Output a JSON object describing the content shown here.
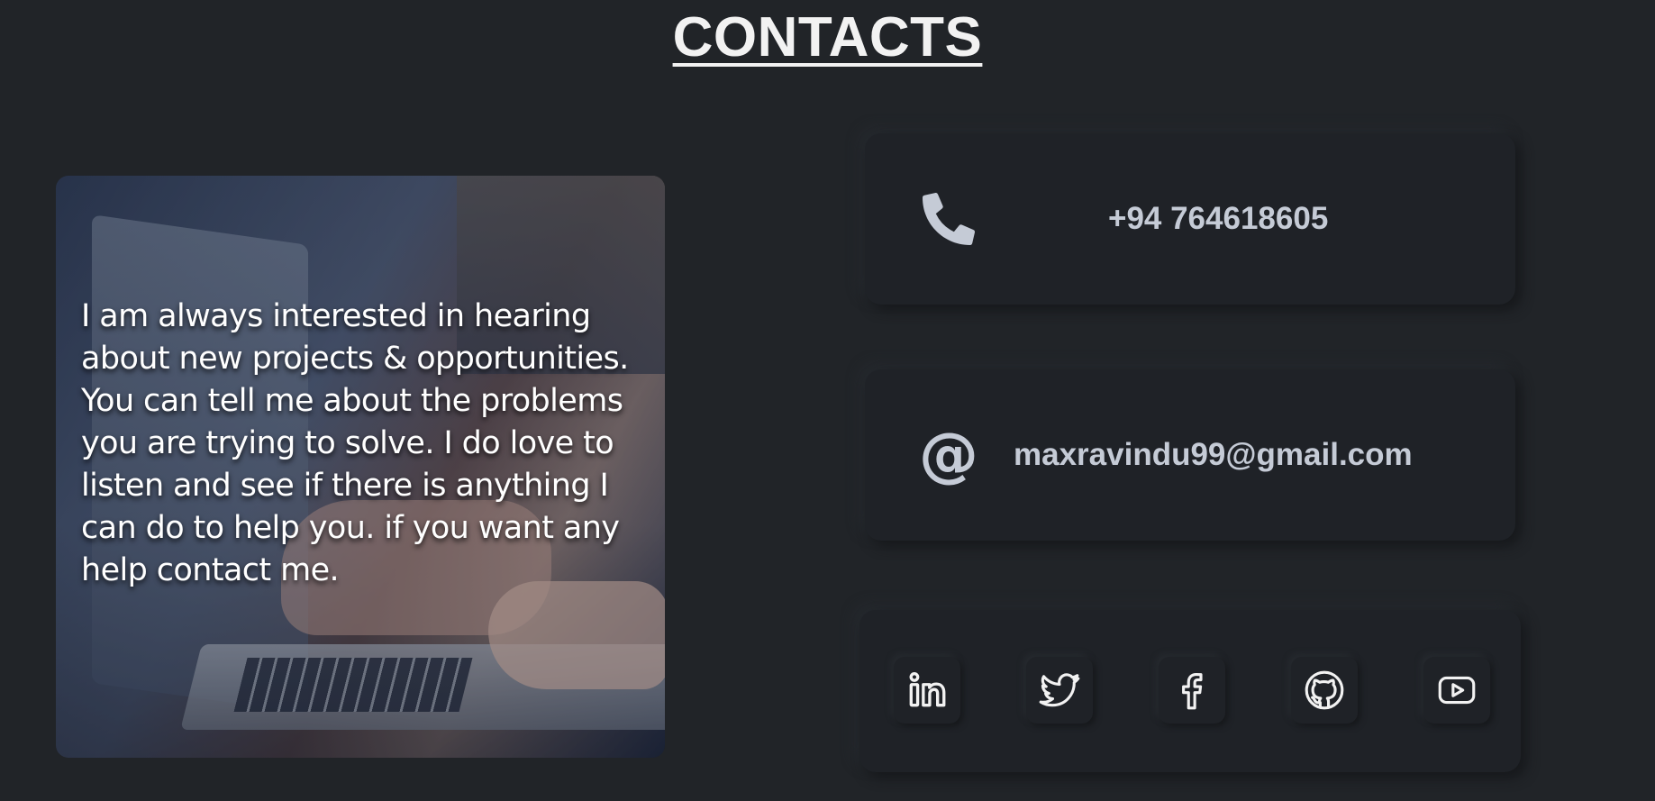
{
  "section": {
    "title": "CONTACTS"
  },
  "about": {
    "message": "I am always interested in hearing about new projects & opportunities. You can tell me about the problems you are trying to solve. I do love to listen and see if there is anything I can do to help you. if you want any help contact me."
  },
  "contact": {
    "phone": {
      "icon": "phone-icon",
      "value": "+94 764618605"
    },
    "email": {
      "icon": "at-icon",
      "glyph": "@",
      "value": "maxravindu99@gmail.com"
    }
  },
  "social": [
    {
      "name": "linkedin",
      "icon": "linkedin-icon"
    },
    {
      "name": "twitter",
      "icon": "twitter-icon"
    },
    {
      "name": "facebook",
      "icon": "facebook-icon"
    },
    {
      "name": "github",
      "icon": "github-icon"
    },
    {
      "name": "youtube",
      "icon": "youtube-icon"
    }
  ],
  "colors": {
    "background": "#212428",
    "card": "#1f2227",
    "text_primary": "#f2f2f2",
    "text_secondary": "#c5cbd6"
  }
}
